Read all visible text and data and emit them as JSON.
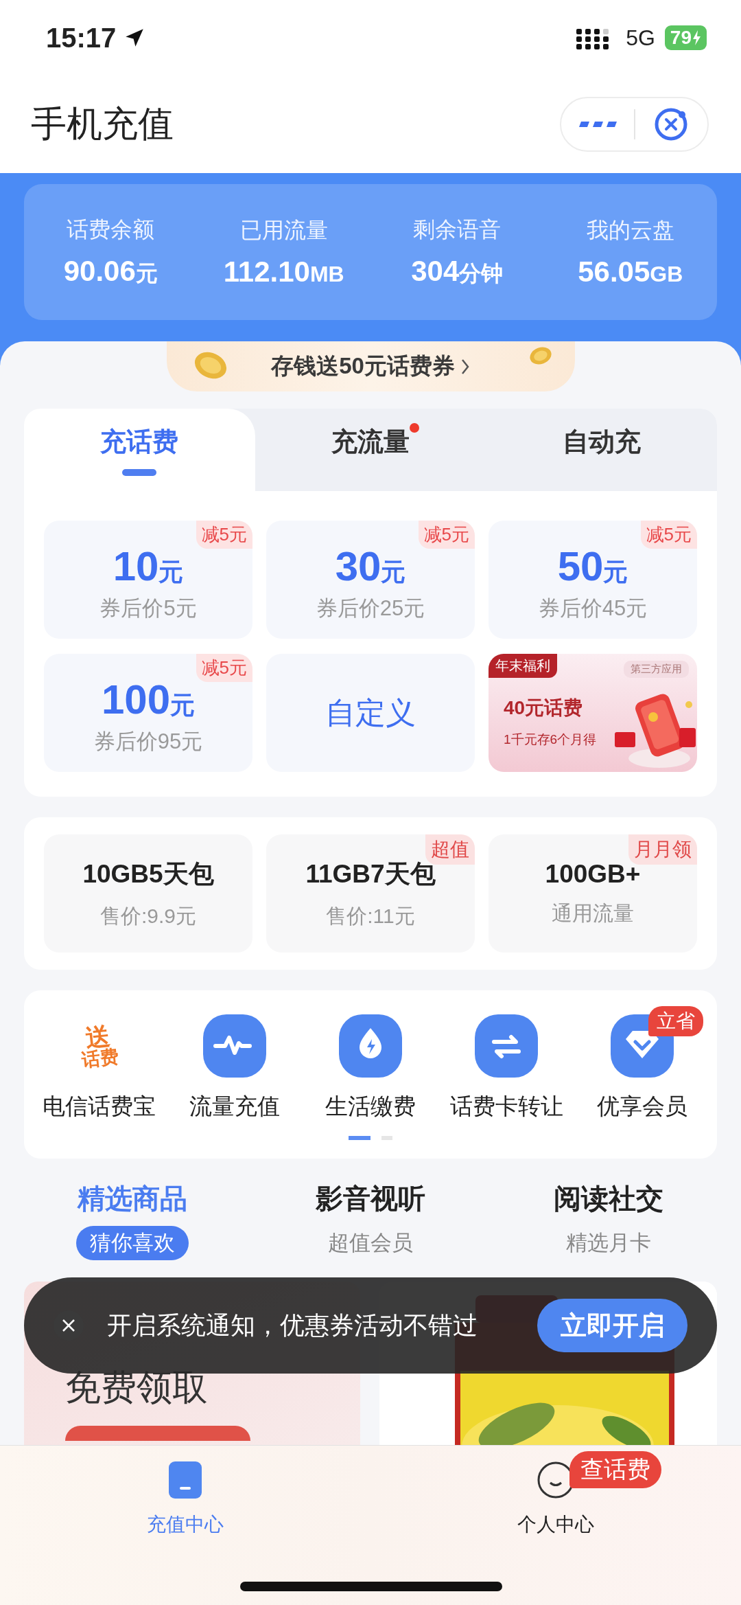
{
  "status_bar": {
    "time": "15:17",
    "network": "5G",
    "battery": "79"
  },
  "header": {
    "title": "手机充值"
  },
  "account_stats": [
    {
      "label": "话费余额",
      "value": "90.06",
      "unit": "元"
    },
    {
      "label": "已用流量",
      "value": "112.10",
      "unit": "MB"
    },
    {
      "label": "剩余语音",
      "value": "304",
      "unit": "分钟"
    },
    {
      "label": "我的云盘",
      "value": "56.05",
      "unit": "GB"
    }
  ],
  "promo_banner": {
    "text": "存钱送50元话费券"
  },
  "recharge_tabs": [
    {
      "label": "充话费",
      "selected": true,
      "dot": false
    },
    {
      "label": "充流量",
      "selected": false,
      "dot": true
    },
    {
      "label": "自动充",
      "selected": false,
      "dot": false
    }
  ],
  "recharge_options": [
    {
      "kind": "amount",
      "amount": "10",
      "unit": "元",
      "price": "券后价5元",
      "tag": "减5元"
    },
    {
      "kind": "amount",
      "amount": "30",
      "unit": "元",
      "price": "券后价25元",
      "tag": "减5元"
    },
    {
      "kind": "amount",
      "amount": "50",
      "unit": "元",
      "price": "券后价45元",
      "tag": "减5元"
    },
    {
      "kind": "amount",
      "amount": "100",
      "unit": "元",
      "price": "券后价95元",
      "tag": "减5元"
    },
    {
      "kind": "custom",
      "label": "自定义"
    },
    {
      "kind": "ad",
      "corner_tag": "年末福利",
      "source_tag": "第三方应用",
      "title": "40元话费",
      "subtitle": "1千元存6个月得"
    }
  ],
  "data_packages": [
    {
      "name": "10GB5天包",
      "price": "售价:9.9元"
    },
    {
      "name": "11GB7天包",
      "price": "售价:11元",
      "tag": "超值"
    },
    {
      "name": "100GB+",
      "price": "通用流量",
      "tag": "月月领"
    }
  ],
  "services": [
    {
      "kind": "logo_text",
      "logo_text": [
        "送",
        "话费"
      ],
      "label": "电信话费宝"
    },
    {
      "kind": "icon",
      "label": "流量充值"
    },
    {
      "kind": "icon",
      "label": "生活缴费"
    },
    {
      "kind": "icon",
      "label": "话费卡转让"
    },
    {
      "kind": "icon",
      "label": "优享会员",
      "badge": "立省"
    }
  ],
  "service_pages": [
    {
      "selected": true
    },
    {
      "selected": false
    }
  ],
  "category_tabs": [
    {
      "title": "精选商品",
      "subtitle": "猜你喜欢",
      "selected": true
    },
    {
      "title": "影音视听",
      "subtitle": "超值会员",
      "selected": false
    },
    {
      "title": "阅读社交",
      "subtitle": "精选月卡",
      "selected": false
    }
  ],
  "feed": [
    {
      "kind": "promo",
      "text": "免费领取"
    },
    {
      "kind": "picture"
    }
  ],
  "toast": {
    "text": "开启系统通知，优惠券活动不错过",
    "button": "立即开启"
  },
  "tab_bar": [
    {
      "label": "充值中心",
      "selected": true
    },
    {
      "label": "个人中心",
      "selected": false,
      "badge": "查话费"
    }
  ]
}
